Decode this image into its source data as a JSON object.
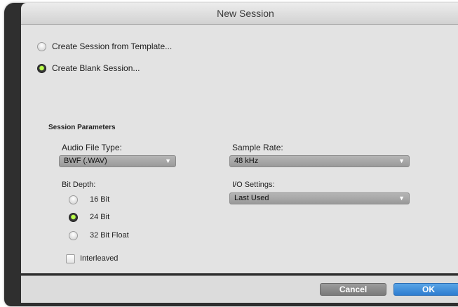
{
  "window": {
    "title": "New Session"
  },
  "session_mode": {
    "options": [
      {
        "label": "Create Session from Template...",
        "selected": false
      },
      {
        "label": "Create Blank Session...",
        "selected": true
      }
    ]
  },
  "parameters": {
    "heading": "Session Parameters",
    "audio_file_type": {
      "label": "Audio File Type:",
      "value": "BWF (.WAV)"
    },
    "sample_rate": {
      "label": "Sample Rate:",
      "value": "48 kHz"
    },
    "bit_depth": {
      "label": "Bit Depth:",
      "options": [
        {
          "label": "16 Bit",
          "selected": false
        },
        {
          "label": "24 Bit",
          "selected": true
        },
        {
          "label": "32 Bit Float",
          "selected": false
        }
      ]
    },
    "io_settings": {
      "label": "I/O Settings:",
      "value": "Last Used"
    },
    "interleaved": {
      "label": "Interleaved",
      "checked": false
    }
  },
  "buttons": {
    "cancel": "Cancel",
    "ok": "OK"
  },
  "icons": {
    "dropdown": "chevron-down-icon"
  },
  "colors": {
    "accent_green": "#b9ff4a",
    "ok_blue": "#2e7dd0"
  }
}
